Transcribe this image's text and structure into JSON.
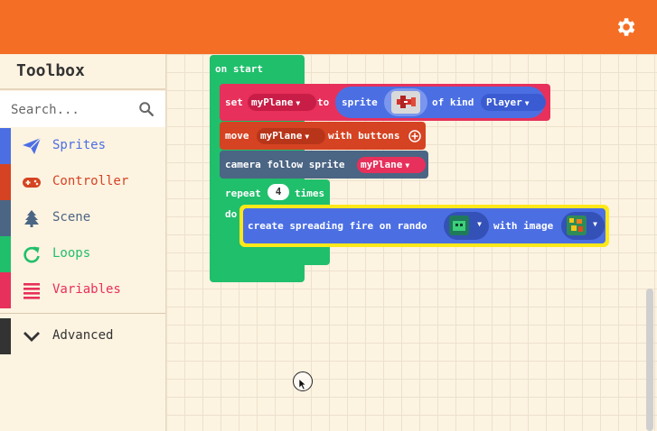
{
  "header": {
    "settings_icon": "gear-icon",
    "color": "#f46f25"
  },
  "toolbox": {
    "title": "Toolbox",
    "search": {
      "placeholder": "Search...",
      "value": ""
    },
    "categories": [
      {
        "label": "Sprites",
        "icon": "paper-plane-icon",
        "color": "#4b6fe3"
      },
      {
        "label": "Controller",
        "icon": "gamepad-icon",
        "color": "#d54322"
      },
      {
        "label": "Scene",
        "icon": "tree-icon",
        "color": "#4b6584"
      },
      {
        "label": "Loops",
        "icon": "loop-icon",
        "color": "#20bf6b"
      },
      {
        "label": "Variables",
        "icon": "list-icon",
        "color": "#e7305b"
      }
    ],
    "advanced": {
      "label": "Advanced",
      "icon": "chevron-down-icon",
      "color": "#333333"
    }
  },
  "blocks": {
    "on_start": "on start",
    "set": "set",
    "set_var": "myPlane",
    "to": "to",
    "sprite": "sprite",
    "of_kind": "of kind",
    "kind": "Player",
    "move": "move",
    "move_var": "myPlane",
    "with_buttons": "with buttons",
    "camera_follow": "camera follow sprite",
    "camera_var": "myPlane",
    "repeat": "repeat",
    "repeat_count": "4",
    "times": "times",
    "do": "do",
    "create_fire": "create spreading fire on rando",
    "with_image": "with image"
  }
}
